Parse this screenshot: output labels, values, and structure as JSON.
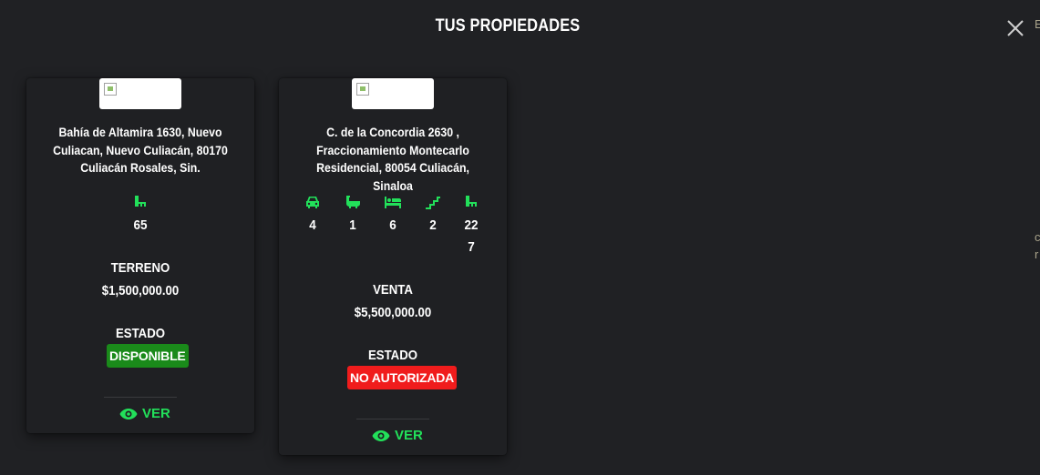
{
  "modal": {
    "title": "TUS PROPIEDADES"
  },
  "edge_fragments": [
    "E",
    "c",
    "r"
  ],
  "accent_color": "#22e05a",
  "properties": [
    {
      "address": "Bahía de Altamira 1630, Nuevo Culiacan, Nuevo Culiacán, 80170 Culiacán Rosales, Sin.",
      "features": [
        {
          "icon": "area-icon",
          "value": "65"
        }
      ],
      "operation": "TERRENO",
      "price": "$1,500,000.00",
      "status_label": "ESTADO",
      "status": "DISPONIBLE",
      "status_color": "#1a8a1a",
      "action_label": "VER"
    },
    {
      "address": "C. de la Concordia 2630 , Fraccionamiento Montecarlo Residencial, 80054 Culiacán, Sinaloa",
      "features": [
        {
          "icon": "car-icon",
          "value": "4"
        },
        {
          "icon": "bathtub-icon",
          "value": "1"
        },
        {
          "icon": "bed-icon",
          "value": "6"
        },
        {
          "icon": "stairs-icon",
          "value": "2"
        },
        {
          "icon": "area-icon",
          "value": "227"
        }
      ],
      "operation": "VENTA",
      "price": "$5,500,000.00",
      "status_label": "ESTADO",
      "status": "NO AUTORIZADA",
      "status_color": "#f01c1c",
      "action_label": "VER"
    }
  ]
}
